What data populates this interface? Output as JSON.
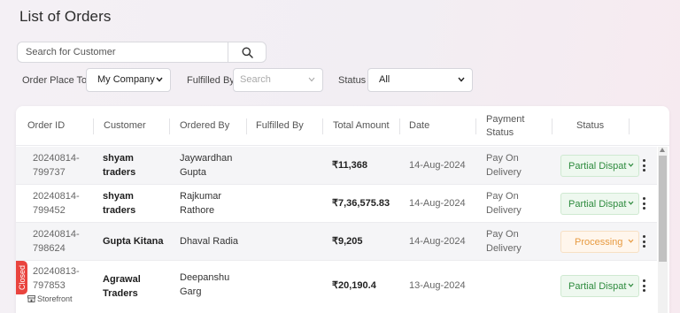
{
  "page": {
    "title": "List of Orders"
  },
  "search": {
    "placeholder": "Search for Customer"
  },
  "filters": {
    "order_place_to": {
      "label": "Order Place To",
      "value": "My Company"
    },
    "fulfilled_by": {
      "label": "Fulfilled By",
      "placeholder": "Search"
    },
    "status": {
      "label": "Status",
      "value": "All"
    }
  },
  "table": {
    "columns": [
      "Order ID",
      "Customer",
      "Ordered By",
      "Fulfilled By",
      "Total Amount",
      "Date",
      "Payment\nStatus",
      "Status"
    ],
    "rows": [
      {
        "order_id": "20240814-\n799737",
        "customer": "shyam\ntraders",
        "ordered_by": "Jaywardhan\nGupta",
        "fulfilled_by": "",
        "amount": "₹11,368",
        "date": "14-Aug-2024",
        "payment": "Pay On\nDelivery",
        "status": "Partial Dispatched"
      },
      {
        "order_id": "20240814-\n799452",
        "customer": "shyam\ntraders",
        "ordered_by": "Rajkumar\nRathore",
        "fulfilled_by": "",
        "amount": "₹7,36,575.83",
        "date": "14-Aug-2024",
        "payment": "Pay On\nDelivery",
        "status": "Partial Dispatched"
      },
      {
        "order_id": "20240814-\n798624",
        "customer": "Gupta Kitana",
        "ordered_by": "Dhaval Radia",
        "fulfilled_by": "",
        "amount": "₹9,205",
        "date": "14-Aug-2024",
        "payment": "Pay On\nDelivery",
        "status": "Processing"
      },
      {
        "order_id": "20240813-\n797853",
        "customer": "Agrawal\nTraders",
        "ordered_by": "Deepanshu\nGarg",
        "fulfilled_by": "",
        "amount": "₹20,190.4",
        "date": "13-Aug-2024",
        "payment": "",
        "status": "Partial Dispatched",
        "tag": "Closed",
        "source": "Storefront"
      }
    ]
  },
  "colors": {
    "partial": "#2e8b3e",
    "processing": "#e79a40",
    "closed": "#e9443e"
  },
  "icons": {
    "search": "search-icon",
    "dropdown": "chevron-down-icon",
    "more": "kebab-icon",
    "storefront": "store-icon"
  }
}
